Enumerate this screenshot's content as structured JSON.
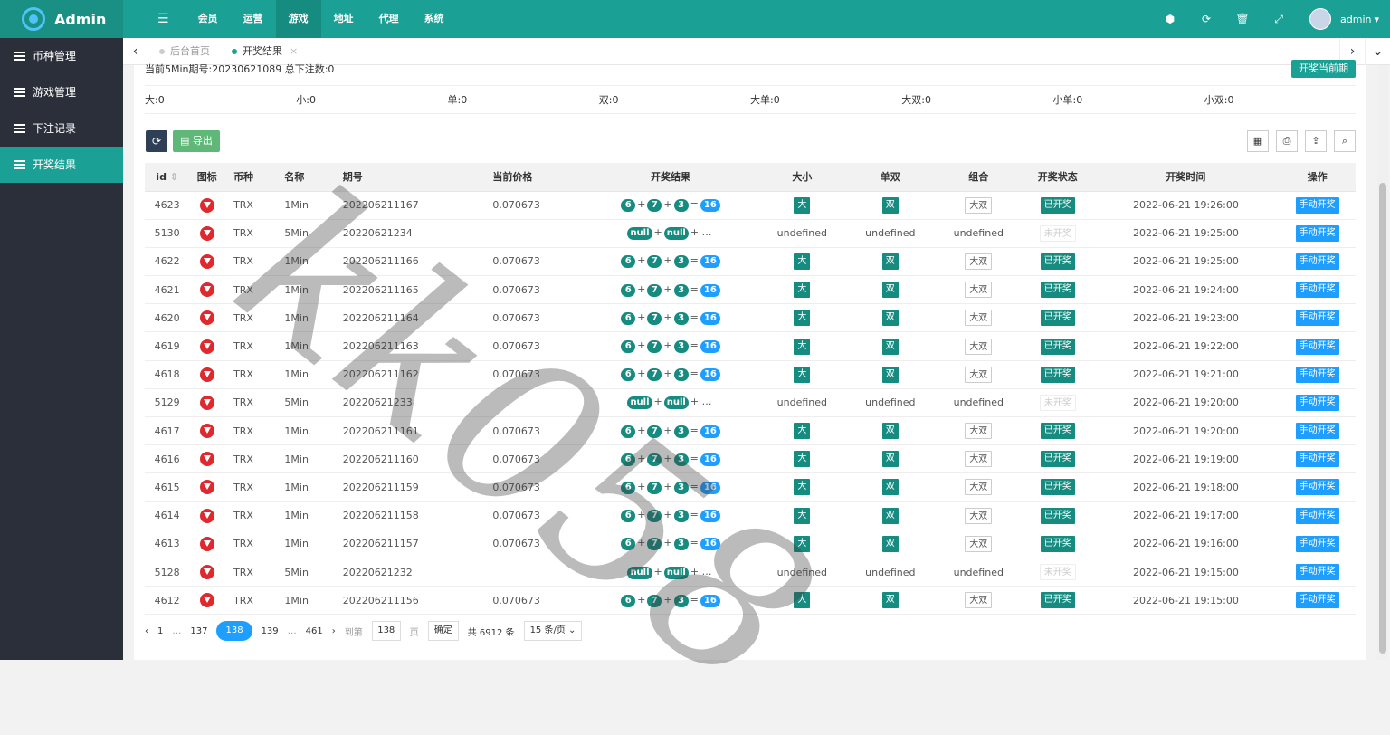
{
  "app": {
    "title": "Admin"
  },
  "topnav": {
    "items": [
      {
        "label": "会员"
      },
      {
        "label": "运营"
      },
      {
        "label": "游戏"
      },
      {
        "label": "地址"
      },
      {
        "label": "代理"
      },
      {
        "label": "系统"
      }
    ],
    "user": "admin",
    "dropdown_glyph": "▾"
  },
  "sidebar": {
    "items": [
      {
        "label": "币种管理"
      },
      {
        "label": "游戏管理"
      },
      {
        "label": "下注记录"
      },
      {
        "label": "开奖结果"
      }
    ]
  },
  "tabs": [
    {
      "label": "后台首页"
    },
    {
      "label": "开奖结果"
    }
  ],
  "summary": "当前5Min期号:20230621089 总下注数:0",
  "draw_button": "开奖当前期",
  "stats": [
    "大:0",
    "小:0",
    "单:0",
    "双:0",
    "大单:0",
    "大双:0",
    "小单:0",
    "小双:0"
  ],
  "toolbar": {
    "export_label": "导出"
  },
  "table": {
    "headers": [
      "id",
      "图标",
      "币种",
      "名称",
      "期号",
      "当前价格",
      "开奖结果",
      "大小",
      "单双",
      "组合",
      "开奖状态",
      "开奖时间",
      "操作"
    ],
    "rows": [
      {
        "id": "4623",
        "coin": "TRX",
        "name": "1Min",
        "period": "202206211167",
        "price": "0.070673",
        "balls": [
          "6",
          "7",
          "3",
          "16"
        ],
        "size": "大",
        "parity": "双",
        "combo": "大双",
        "status": "已开奖",
        "drawn": true,
        "time": "2022-06-21 19:26:00",
        "action": "手动开奖"
      },
      {
        "id": "5130",
        "coin": "TRX",
        "name": "5Min",
        "period": "20220621234",
        "price": "",
        "balls": [
          "null",
          "null"
        ],
        "size": "undefined",
        "parity": "undefined",
        "combo": "undefined",
        "status": "未开奖",
        "drawn": false,
        "time": "2022-06-21 19:25:00",
        "action": "手动开奖"
      },
      {
        "id": "4622",
        "coin": "TRX",
        "name": "1Min",
        "period": "202206211166",
        "price": "0.070673",
        "balls": [
          "6",
          "7",
          "3",
          "16"
        ],
        "size": "大",
        "parity": "双",
        "combo": "大双",
        "status": "已开奖",
        "drawn": true,
        "time": "2022-06-21 19:25:00",
        "action": "手动开奖"
      },
      {
        "id": "4621",
        "coin": "TRX",
        "name": "1Min",
        "period": "202206211165",
        "price": "0.070673",
        "balls": [
          "6",
          "7",
          "3",
          "16"
        ],
        "size": "大",
        "parity": "双",
        "combo": "大双",
        "status": "已开奖",
        "drawn": true,
        "time": "2022-06-21 19:24:00",
        "action": "手动开奖"
      },
      {
        "id": "4620",
        "coin": "TRX",
        "name": "1Min",
        "period": "202206211164",
        "price": "0.070673",
        "balls": [
          "6",
          "7",
          "3",
          "16"
        ],
        "size": "大",
        "parity": "双",
        "combo": "大双",
        "status": "已开奖",
        "drawn": true,
        "time": "2022-06-21 19:23:00",
        "action": "手动开奖"
      },
      {
        "id": "4619",
        "coin": "TRX",
        "name": "1Min",
        "period": "202206211163",
        "price": "0.070673",
        "balls": [
          "6",
          "7",
          "3",
          "16"
        ],
        "size": "大",
        "parity": "双",
        "combo": "大双",
        "status": "已开奖",
        "drawn": true,
        "time": "2022-06-21 19:22:00",
        "action": "手动开奖"
      },
      {
        "id": "4618",
        "coin": "TRX",
        "name": "1Min",
        "period": "202206211162",
        "price": "0.070673",
        "balls": [
          "6",
          "7",
          "3",
          "16"
        ],
        "size": "大",
        "parity": "双",
        "combo": "大双",
        "status": "已开奖",
        "drawn": true,
        "time": "2022-06-21 19:21:00",
        "action": "手动开奖"
      },
      {
        "id": "5129",
        "coin": "TRX",
        "name": "5Min",
        "period": "20220621233",
        "price": "",
        "balls": [
          "null",
          "null"
        ],
        "size": "undefined",
        "parity": "undefined",
        "combo": "undefined",
        "status": "未开奖",
        "drawn": false,
        "time": "2022-06-21 19:20:00",
        "action": "手动开奖"
      },
      {
        "id": "4617",
        "coin": "TRX",
        "name": "1Min",
        "period": "202206211161",
        "price": "0.070673",
        "balls": [
          "6",
          "7",
          "3",
          "16"
        ],
        "size": "大",
        "parity": "双",
        "combo": "大双",
        "status": "已开奖",
        "drawn": true,
        "time": "2022-06-21 19:20:00",
        "action": "手动开奖"
      },
      {
        "id": "4616",
        "coin": "TRX",
        "name": "1Min",
        "period": "202206211160",
        "price": "0.070673",
        "balls": [
          "6",
          "7",
          "3",
          "16"
        ],
        "size": "大",
        "parity": "双",
        "combo": "大双",
        "status": "已开奖",
        "drawn": true,
        "time": "2022-06-21 19:19:00",
        "action": "手动开奖"
      },
      {
        "id": "4615",
        "coin": "TRX",
        "name": "1Min",
        "period": "202206211159",
        "price": "0.070673",
        "balls": [
          "6",
          "7",
          "3",
          "16"
        ],
        "size": "大",
        "parity": "双",
        "combo": "大双",
        "status": "已开奖",
        "drawn": true,
        "time": "2022-06-21 19:18:00",
        "action": "手动开奖"
      },
      {
        "id": "4614",
        "coin": "TRX",
        "name": "1Min",
        "period": "202206211158",
        "price": "0.070673",
        "balls": [
          "6",
          "7",
          "3",
          "16"
        ],
        "size": "大",
        "parity": "双",
        "combo": "大双",
        "status": "已开奖",
        "drawn": true,
        "time": "2022-06-21 19:17:00",
        "action": "手动开奖"
      },
      {
        "id": "4613",
        "coin": "TRX",
        "name": "1Min",
        "period": "202206211157",
        "price": "0.070673",
        "balls": [
          "6",
          "7",
          "3",
          "16"
        ],
        "size": "大",
        "parity": "双",
        "combo": "大双",
        "status": "已开奖",
        "drawn": true,
        "time": "2022-06-21 19:16:00",
        "action": "手动开奖"
      },
      {
        "id": "5128",
        "coin": "TRX",
        "name": "5Min",
        "period": "20220621232",
        "price": "",
        "balls": [
          "null",
          "null"
        ],
        "size": "undefined",
        "parity": "undefined",
        "combo": "undefined",
        "status": "未开奖",
        "drawn": false,
        "time": "2022-06-21 19:15:00",
        "action": "手动开奖"
      },
      {
        "id": "4612",
        "coin": "TRX",
        "name": "1Min",
        "period": "202206211156",
        "price": "0.070673",
        "balls": [
          "6",
          "7",
          "3",
          "16"
        ],
        "size": "大",
        "parity": "双",
        "combo": "大双",
        "status": "已开奖",
        "drawn": true,
        "time": "2022-06-21 19:15:00",
        "action": "手动开奖"
      }
    ]
  },
  "pagination": {
    "pages": [
      "1",
      "…",
      "137",
      "138",
      "139",
      "…",
      "461"
    ],
    "current": "138",
    "goto_label": "到第",
    "goto_value": "138",
    "page_label": "页",
    "confirm": "确定",
    "total": "共 6912 条",
    "per_page": "15 条/页"
  },
  "watermark": "kk058",
  "colors": {
    "primary": "#1aa094",
    "sidebar": "#2b2f3a",
    "blue": "#1e9fff",
    "danger": "#e0292e"
  }
}
